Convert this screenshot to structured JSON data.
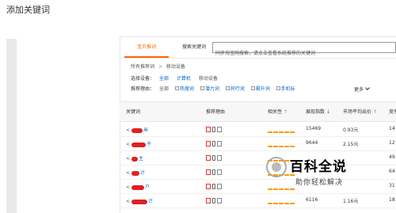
{
  "page": {
    "title": "添加关键词"
  },
  "tabs": [
    {
      "label": "宝贝推词",
      "active": true
    },
    {
      "label": "搜索关键词",
      "active": false
    }
  ],
  "search": {
    "placeholder": "同步淘宝网搜索，请点击查看系统推荐的关键词"
  },
  "filters": {
    "breadcrumb": {
      "root": "所有推荐词",
      "separator": ">",
      "current": "移动设备"
    },
    "device": {
      "label": "选择设备：",
      "options": [
        "全部",
        "计算机",
        "移动设备"
      ]
    },
    "reason": {
      "label": "推荐理由：",
      "options": [
        "全部",
        "热搜词",
        "潜力词",
        "同行词",
        "飙升词",
        "手机标"
      ]
    },
    "more_label": "更多"
  },
  "table": {
    "columns": {
      "keyword": "关键词",
      "reason": "推荐理由",
      "relevance": "相关性",
      "impressions": "展现指数",
      "avg_price": "市场平均出价",
      "competition": "竞争"
    },
    "rows": [
      {
        "kw_prefix": "<",
        "kw_suffix": "米",
        "index": "15469",
        "price": "0.93元",
        "comp": "14",
        "relevance": 5
      },
      {
        "kw_prefix": "<",
        "kw_suffix": "子",
        "index": "9644",
        "price": "2.15元",
        "comp": "12",
        "relevance": 5
      },
      {
        "kw_prefix": "<",
        "kw_suffix": "主",
        "index": "",
        "price": "",
        "comp": "49",
        "relevance": 5
      },
      {
        "kw_prefix": "<",
        "kw_suffix": "计",
        "index": "",
        "price": "",
        "comp": "64",
        "relevance": 5
      },
      {
        "kw_prefix": "<",
        "kw_suffix": "户",
        "index": "",
        "price": "",
        "comp": "31",
        "relevance": 5
      },
      {
        "kw_prefix": "<",
        "kw_suffix": "计",
        "index": "6116",
        "price": "1.16元",
        "comp": "18",
        "relevance": 5
      }
    ]
  },
  "watermark": {
    "big": "百科全说",
    "small": "助你轻松解决"
  },
  "colors": {
    "accent": "#ff6600",
    "link": "#0066cc",
    "bar": "#ff9900",
    "redact": "#e02020"
  }
}
